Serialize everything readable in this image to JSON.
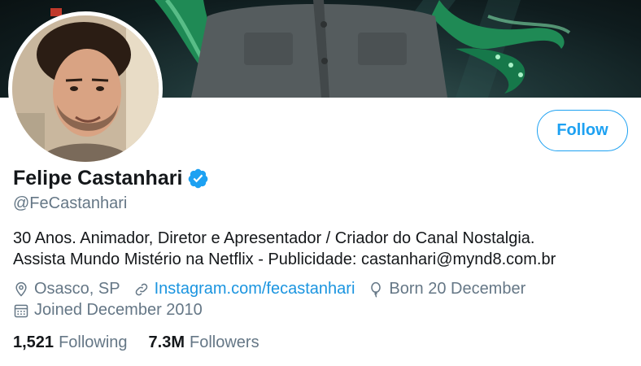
{
  "profile": {
    "display_name": "Felipe Castanhari",
    "handle": "@FeCastanhari",
    "bio_line1": "30 Anos. Animador, Diretor e Apresentador / Criador do Canal Nostalgia.",
    "bio_line2": "Assista Mundo Mistério na Netflix - Publicidade: castanhari@mynd8.com.br",
    "location": "Osasco, SP",
    "website": "Instagram.com/fecastanhari",
    "birthday": "Born 20 December",
    "joined": "Joined December 2010"
  },
  "actions": {
    "follow_label": "Follow"
  },
  "stats": {
    "following_count": "1,521",
    "following_label": "Following",
    "followers_count": "7.3M",
    "followers_label": "Followers"
  },
  "icons": {
    "verified": "verified-badge-icon",
    "location": "location-pin-icon",
    "link": "link-icon",
    "birthday": "balloon-icon",
    "calendar": "calendar-icon"
  },
  "colors": {
    "accent": "#1da1f2",
    "link": "#1b95e0",
    "secondary_text": "#657786",
    "primary_text": "#14171a"
  }
}
